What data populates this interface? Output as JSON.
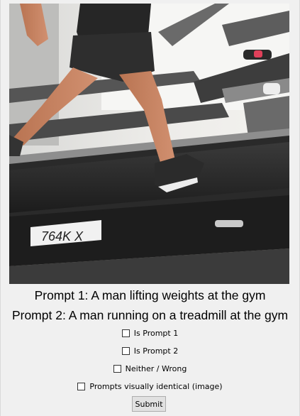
{
  "image": {
    "alt_icon": "photo-treadmill-runner",
    "machine_label": "764K X"
  },
  "prompts": {
    "prompt1": "Prompt 1: A man lifting weights at the gym",
    "prompt2": "Prompt 2: A man running on a treadmill at the gym"
  },
  "choices": [
    {
      "label": "Is Prompt 1",
      "checked": false
    },
    {
      "label": "Is Prompt 2",
      "checked": false
    },
    {
      "label": "Neither / Wrong",
      "checked": false
    },
    {
      "label": "Prompts visually identical (image)",
      "checked": false
    }
  ],
  "submit_label": "Submit"
}
